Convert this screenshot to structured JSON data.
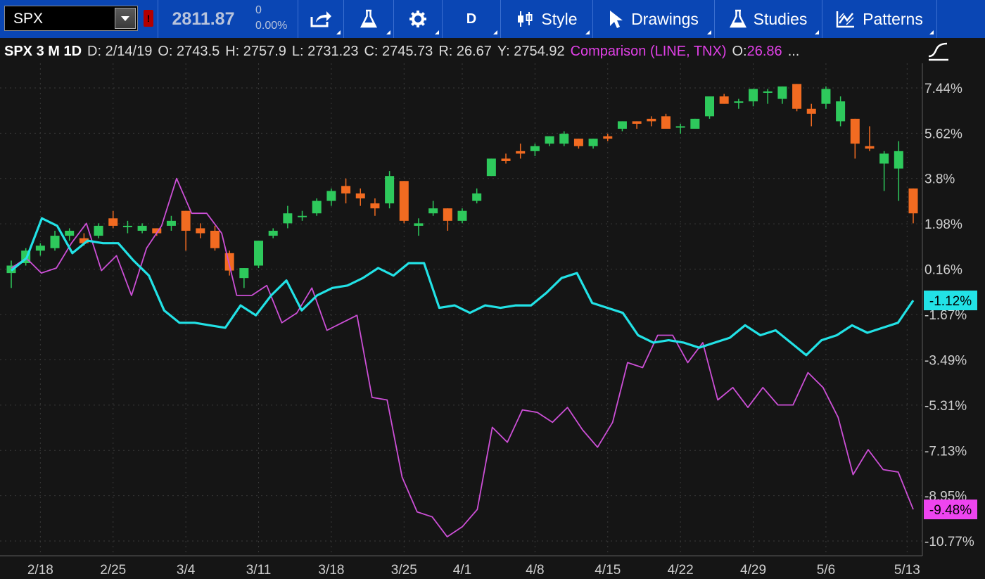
{
  "toolbar": {
    "symbol": "SPX",
    "flag": "!",
    "price": "2811.87",
    "change": "0",
    "change_pct": "0.00%",
    "buttons": {
      "period": "D",
      "style": "Style",
      "drawings": "Drawings",
      "studies": "Studies",
      "patterns": "Patterns"
    }
  },
  "infobar": {
    "name": "SPX 3 M 1D",
    "date": "D: 2/14/19",
    "open": "O: 2743.5",
    "high": "H: 2757.9",
    "low": "L: 2731.23",
    "close": "C: 2745.73",
    "range": "R: 26.67",
    "y": "Y: 2754.92",
    "comparison": "Comparison (LINE, TNX)",
    "comparison_open": "O: ",
    "comparison_open_value": "26.86",
    "more": "..."
  },
  "colors": {
    "up_candle": "#2ec95c",
    "down_candle": "#f26b21",
    "price_line": "#22e2e6",
    "comparison_line": "#cc4fd6",
    "grid": "#3a3a3a",
    "toolbar": "#0a46b4"
  },
  "chart_data": {
    "type": "line",
    "y_axis_ticks": [
      "7.44%",
      "5.62%",
      "3.8%",
      "1.98%",
      "0.16%",
      "-1.67%",
      "-3.49%",
      "-5.31%",
      "-7.13%",
      "-8.95%",
      "-10.77%"
    ],
    "ylim": [
      -10.77,
      7.44
    ],
    "x_axis_ticks": [
      "2/18",
      "2/25",
      "3/4",
      "3/11",
      "3/18",
      "3/25",
      "4/1",
      "4/8",
      "4/15",
      "4/22",
      "4/29",
      "5/6",
      "5/13"
    ],
    "end_labels": [
      "-1.12%",
      "-9.48%"
    ],
    "candles": [
      {
        "o": 0.0,
        "h": 0.5,
        "l": -0.6,
        "c": 0.3
      },
      {
        "o": 0.4,
        "h": 1.0,
        "l": 0.3,
        "c": 0.9
      },
      {
        "o": 0.9,
        "h": 1.2,
        "l": 0.7,
        "c": 1.1
      },
      {
        "o": 1.0,
        "h": 1.7,
        "l": 0.9,
        "c": 1.5
      },
      {
        "o": 1.5,
        "h": 1.8,
        "l": 1.3,
        "c": 1.7
      },
      {
        "o": 1.4,
        "h": 1.6,
        "l": 1.1,
        "c": 1.2
      },
      {
        "o": 1.5,
        "h": 2.0,
        "l": 1.4,
        "c": 1.9
      },
      {
        "o": 2.2,
        "h": 2.5,
        "l": 1.8,
        "c": 1.9
      },
      {
        "o": 1.9,
        "h": 2.1,
        "l": 1.6,
        "c": 1.9
      },
      {
        "o": 1.7,
        "h": 2.0,
        "l": 1.6,
        "c": 1.9
      },
      {
        "o": 1.8,
        "h": 1.8,
        "l": 1.5,
        "c": 1.6
      },
      {
        "o": 1.9,
        "h": 2.3,
        "l": 1.7,
        "c": 2.1
      },
      {
        "o": 2.5,
        "h": 2.5,
        "l": 0.9,
        "c": 1.7
      },
      {
        "o": 1.8,
        "h": 2.0,
        "l": 1.4,
        "c": 1.6
      },
      {
        "o": 1.7,
        "h": 1.9,
        "l": 0.9,
        "c": 1.0
      },
      {
        "o": 0.8,
        "h": 0.9,
        "l": -0.1,
        "c": 0.1
      },
      {
        "o": -0.2,
        "h": 0.2,
        "l": -0.6,
        "c": 0.2
      },
      {
        "o": 0.3,
        "h": 1.3,
        "l": 0.2,
        "c": 1.3
      },
      {
        "o": 1.5,
        "h": 1.8,
        "l": 1.4,
        "c": 1.7
      },
      {
        "o": 2.0,
        "h": 2.7,
        "l": 1.8,
        "c": 2.4
      },
      {
        "o": 2.3,
        "h": 2.5,
        "l": 2.1,
        "c": 2.3
      },
      {
        "o": 2.4,
        "h": 3.0,
        "l": 2.3,
        "c": 2.9
      },
      {
        "o": 2.9,
        "h": 3.4,
        "l": 2.7,
        "c": 3.3
      },
      {
        "o": 3.5,
        "h": 3.8,
        "l": 2.8,
        "c": 3.2
      },
      {
        "o": 3.2,
        "h": 3.4,
        "l": 2.7,
        "c": 3.0
      },
      {
        "o": 2.8,
        "h": 3.0,
        "l": 2.3,
        "c": 2.6
      },
      {
        "o": 2.8,
        "h": 4.1,
        "l": 2.6,
        "c": 3.9
      },
      {
        "o": 3.7,
        "h": 3.7,
        "l": 2.0,
        "c": 2.1
      },
      {
        "o": 1.9,
        "h": 2.2,
        "l": 1.5,
        "c": 2.0
      },
      {
        "o": 2.4,
        "h": 2.9,
        "l": 2.3,
        "c": 2.6
      },
      {
        "o": 2.6,
        "h": 2.6,
        "l": 1.7,
        "c": 2.1
      },
      {
        "o": 2.1,
        "h": 2.6,
        "l": 2.0,
        "c": 2.5
      },
      {
        "o": 2.9,
        "h": 3.4,
        "l": 2.8,
        "c": 3.2
      },
      {
        "o": 3.9,
        "h": 4.6,
        "l": 3.9,
        "c": 4.6
      },
      {
        "o": 4.6,
        "h": 4.8,
        "l": 4.4,
        "c": 4.5
      },
      {
        "o": 4.9,
        "h": 5.2,
        "l": 4.6,
        "c": 4.8
      },
      {
        "o": 4.9,
        "h": 5.2,
        "l": 4.7,
        "c": 5.1
      },
      {
        "o": 5.2,
        "h": 5.5,
        "l": 5.1,
        "c": 5.5
      },
      {
        "o": 5.2,
        "h": 5.7,
        "l": 5.1,
        "c": 5.6
      },
      {
        "o": 5.4,
        "h": 5.4,
        "l": 5.0,
        "c": 5.1
      },
      {
        "o": 5.1,
        "h": 5.4,
        "l": 5.0,
        "c": 5.4
      },
      {
        "o": 5.5,
        "h": 5.6,
        "l": 5.3,
        "c": 5.4
      },
      {
        "o": 5.8,
        "h": 6.1,
        "l": 5.7,
        "c": 6.1
      },
      {
        "o": 6.1,
        "h": 6.1,
        "l": 5.8,
        "c": 6.0
      },
      {
        "o": 6.2,
        "h": 6.3,
        "l": 5.9,
        "c": 6.1
      },
      {
        "o": 6.3,
        "h": 6.4,
        "l": 5.8,
        "c": 5.8
      },
      {
        "o": 5.9,
        "h": 6.0,
        "l": 5.6,
        "c": 5.9
      },
      {
        "o": 5.8,
        "h": 6.2,
        "l": 5.8,
        "c": 6.2
      },
      {
        "o": 6.3,
        "h": 7.1,
        "l": 6.2,
        "c": 7.1
      },
      {
        "o": 7.1,
        "h": 7.2,
        "l": 6.8,
        "c": 6.8
      },
      {
        "o": 6.9,
        "h": 7.0,
        "l": 6.6,
        "c": 6.9
      },
      {
        "o": 6.9,
        "h": 7.4,
        "l": 6.7,
        "c": 7.4
      },
      {
        "o": 7.3,
        "h": 7.4,
        "l": 6.8,
        "c": 7.3
      },
      {
        "o": 7.0,
        "h": 7.5,
        "l": 6.8,
        "c": 7.5
      },
      {
        "o": 7.6,
        "h": 7.6,
        "l": 6.5,
        "c": 6.6
      },
      {
        "o": 6.6,
        "h": 6.8,
        "l": 5.9,
        "c": 6.4
      },
      {
        "o": 6.8,
        "h": 7.5,
        "l": 6.6,
        "c": 7.4
      },
      {
        "o": 6.1,
        "h": 7.1,
        "l": 5.9,
        "c": 6.9
      },
      {
        "o": 6.2,
        "h": 6.2,
        "l": 4.6,
        "c": 5.2
      },
      {
        "o": 5.1,
        "h": 5.9,
        "l": 4.9,
        "c": 5.0
      },
      {
        "o": 4.4,
        "h": 4.9,
        "l": 3.3,
        "c": 4.8
      },
      {
        "o": 4.2,
        "h": 5.3,
        "l": 2.9,
        "c": 4.9
      },
      {
        "o": 3.4,
        "h": 3.4,
        "l": 2.0,
        "c": 2.4
      }
    ],
    "series": [
      {
        "x_dates_from_start": "2/14/19 to 5/13/19",
        "values": [
          0.1,
          0.6,
          2.2,
          1.9,
          0.8,
          1.3,
          1.2,
          1.2,
          0.5,
          -0.1,
          -1.5,
          -2.0,
          -2.0,
          -2.1,
          -2.2,
          -1.3,
          -1.7,
          -0.9,
          -0.3,
          -1.5,
          -0.9,
          -0.6,
          -0.5,
          -0.2,
          0.2,
          -0.1,
          0.4,
          0.4,
          -1.4,
          -1.3,
          -1.6,
          -1.3,
          -1.4,
          -1.3,
          -1.3,
          -0.8,
          -0.2,
          0.0,
          -1.2,
          -1.4,
          -1.6,
          -2.5,
          -2.8,
          -2.7,
          -2.8,
          -3.0,
          -2.8,
          -2.6,
          -2.1,
          -2.5,
          -2.3,
          -2.8,
          -3.3,
          -2.7,
          -2.5,
          -2.1,
          -2.4,
          -2.2,
          -2.0,
          -1.1
        ]
      },
      {
        "x_dates_from_start": "2/14/19 to 5/13/19",
        "values": [
          0.2,
          0.6,
          0.0,
          0.2,
          1.2,
          2.0,
          0.1,
          0.7,
          -0.9,
          1.0,
          1.9,
          3.8,
          2.4,
          2.4,
          1.6,
          -0.9,
          -0.9,
          -0.5,
          -2.0,
          -1.6,
          -0.6,
          -2.3,
          -2.0,
          -1.7,
          -5.0,
          -5.1,
          -8.2,
          -9.6,
          -9.8,
          -10.6,
          -10.2,
          -9.5,
          -6.2,
          -6.8,
          -5.5,
          -5.6,
          -6.0,
          -5.4,
          -6.3,
          -7.0,
          -6.0,
          -3.6,
          -3.8,
          -2.5,
          -2.5,
          -3.6,
          -2.8,
          -5.1,
          -4.6,
          -5.4,
          -4.6,
          -5.3,
          -5.3,
          -4.0,
          -4.6,
          -5.8,
          -8.1,
          -7.1,
          -7.9,
          -8.0,
          -9.5
        ]
      }
    ]
  }
}
